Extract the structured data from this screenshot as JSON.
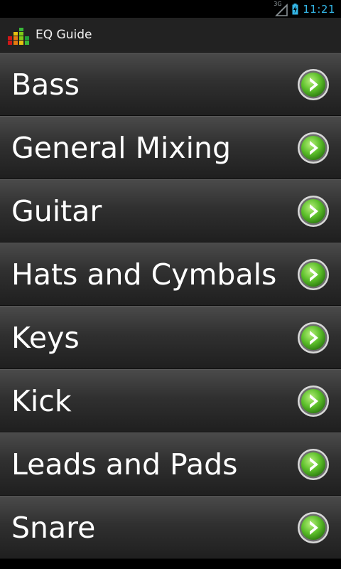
{
  "status_bar": {
    "network": "3G",
    "time": "11:21",
    "icons": [
      "signal-icon",
      "battery-charging-icon"
    ]
  },
  "app": {
    "title": "EQ Guide",
    "icon": "equalizer-icon"
  },
  "list": {
    "items": [
      {
        "label": "Bass"
      },
      {
        "label": "General Mixing"
      },
      {
        "label": "Guitar"
      },
      {
        "label": "Hats and Cymbals"
      },
      {
        "label": "Keys"
      },
      {
        "label": "Kick"
      },
      {
        "label": "Leads and Pads"
      },
      {
        "label": "Snare"
      }
    ],
    "item_icon": "chevron-right-circle-icon"
  },
  "colors": {
    "clock": "#33b5e5",
    "chevron_green": "#5cbf2a",
    "row_top": "#4a4a4a",
    "row_bottom": "#1f1f1f"
  }
}
